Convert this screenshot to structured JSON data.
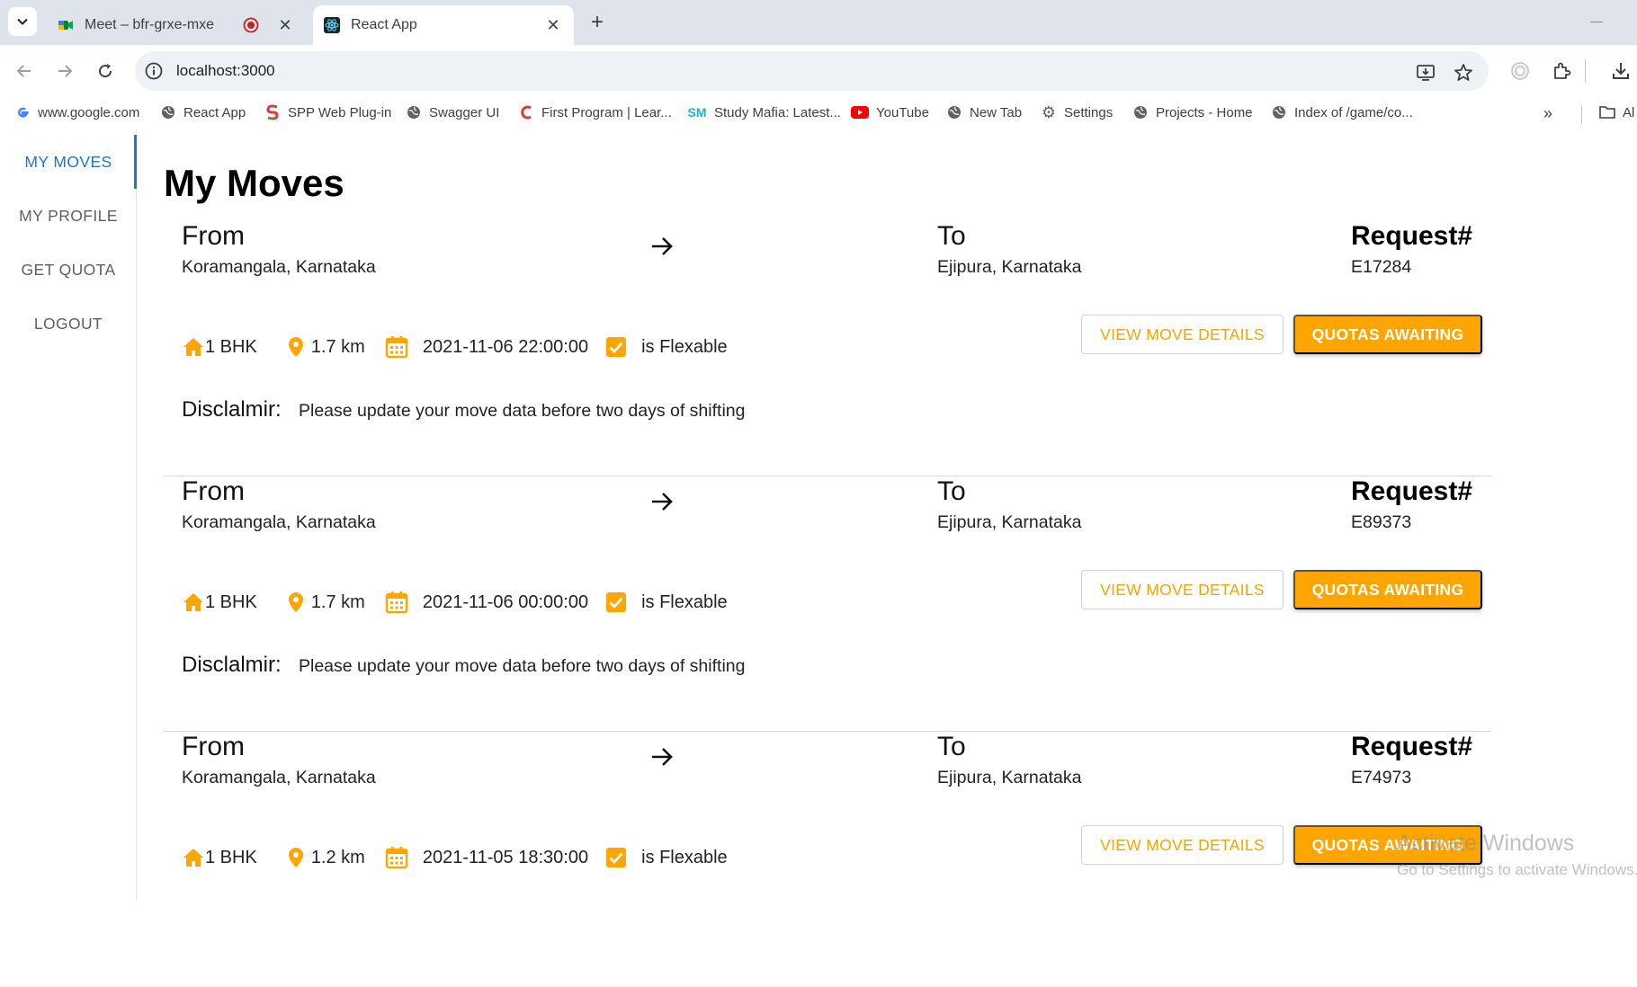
{
  "browser": {
    "tabs": [
      {
        "title": "Meet – bfr-grxe-mxe",
        "active": false,
        "icon": "google-meet-icon"
      },
      {
        "title": "React App",
        "active": true,
        "icon": "react-icon"
      }
    ],
    "new_tab_label": "+",
    "url": "localhost:3000",
    "bookmarks": [
      {
        "label": "www.google.com",
        "icon": "google-icon"
      },
      {
        "label": "React App",
        "icon": "globe-icon"
      },
      {
        "label": "SPP Web Plug-in",
        "icon": "spp-icon"
      },
      {
        "label": "Swagger UI",
        "icon": "globe-icon"
      },
      {
        "label": "First Program | Lear...",
        "icon": "c-icon"
      },
      {
        "label": "Study Mafia: Latest...",
        "icon": "sm-icon"
      },
      {
        "label": "YouTube",
        "icon": "youtube-icon"
      },
      {
        "label": "New Tab",
        "icon": "globe-icon"
      },
      {
        "label": "Settings",
        "icon": "gear-icon"
      },
      {
        "label": "Projects - Home",
        "icon": "globe-icon"
      },
      {
        "label": "Index of /game/co...",
        "icon": "globe-icon"
      }
    ],
    "bookmarks_overflow": "»",
    "bookmarks_folder_label": "Al"
  },
  "sidebar": {
    "items": [
      {
        "label": "MY MOVES",
        "active": true
      },
      {
        "label": "MY PROFILE",
        "active": false
      },
      {
        "label": "GET QUOTA",
        "active": false
      },
      {
        "label": "LOGOUT",
        "active": false
      }
    ]
  },
  "page": {
    "title": "My Moves"
  },
  "moves": [
    {
      "from_label": "From",
      "from": "Koramangala, Karnataka",
      "to_label": "To",
      "to": "Ejipura, Karnataka",
      "request_label": "Request#",
      "request_id": "E17284",
      "size": "1 BHK",
      "distance": "1.7 km",
      "datetime": "2021-11-06 22:00:00",
      "flexible_label": "is Flexable",
      "flexible": true,
      "view_button": "VIEW MOVE DETAILS",
      "status_button": "QUOTAS AWAITING",
      "disclaimer_label": "Disclalmir:",
      "disclaimer_text": "Please update your move data before two days of shifting"
    },
    {
      "from_label": "From",
      "from": "Koramangala, Karnataka",
      "to_label": "To",
      "to": "Ejipura, Karnataka",
      "request_label": "Request#",
      "request_id": "E89373",
      "size": "1 BHK",
      "distance": "1.7 km",
      "datetime": "2021-11-06 00:00:00",
      "flexible_label": "is Flexable",
      "flexible": true,
      "view_button": "VIEW MOVE DETAILS",
      "status_button": "QUOTAS AWAITING",
      "disclaimer_label": "Disclalmir:",
      "disclaimer_text": "Please update your move data before two days of shifting"
    },
    {
      "from_label": "From",
      "from": "Koramangala, Karnataka",
      "to_label": "To",
      "to": "Ejipura, Karnataka",
      "request_label": "Request#",
      "request_id": "E74973",
      "size": "1 BHK",
      "distance": "1.2 km",
      "datetime": "2021-11-05 18:30:00",
      "flexible_label": "is Flexable",
      "flexible": true,
      "view_button": "VIEW MOVE DETAILS",
      "status_button": "QUOTAS AWAITING"
    }
  ],
  "watermark": {
    "title": "Activate Windows",
    "subtitle": "Go to Settings to activate Windows."
  },
  "colors": {
    "accent": "#ffa500",
    "sidebar_active": "#1976d2",
    "tabbar_bg": "#dfe3eb",
    "omnibox_bg": "#eef1f6"
  }
}
